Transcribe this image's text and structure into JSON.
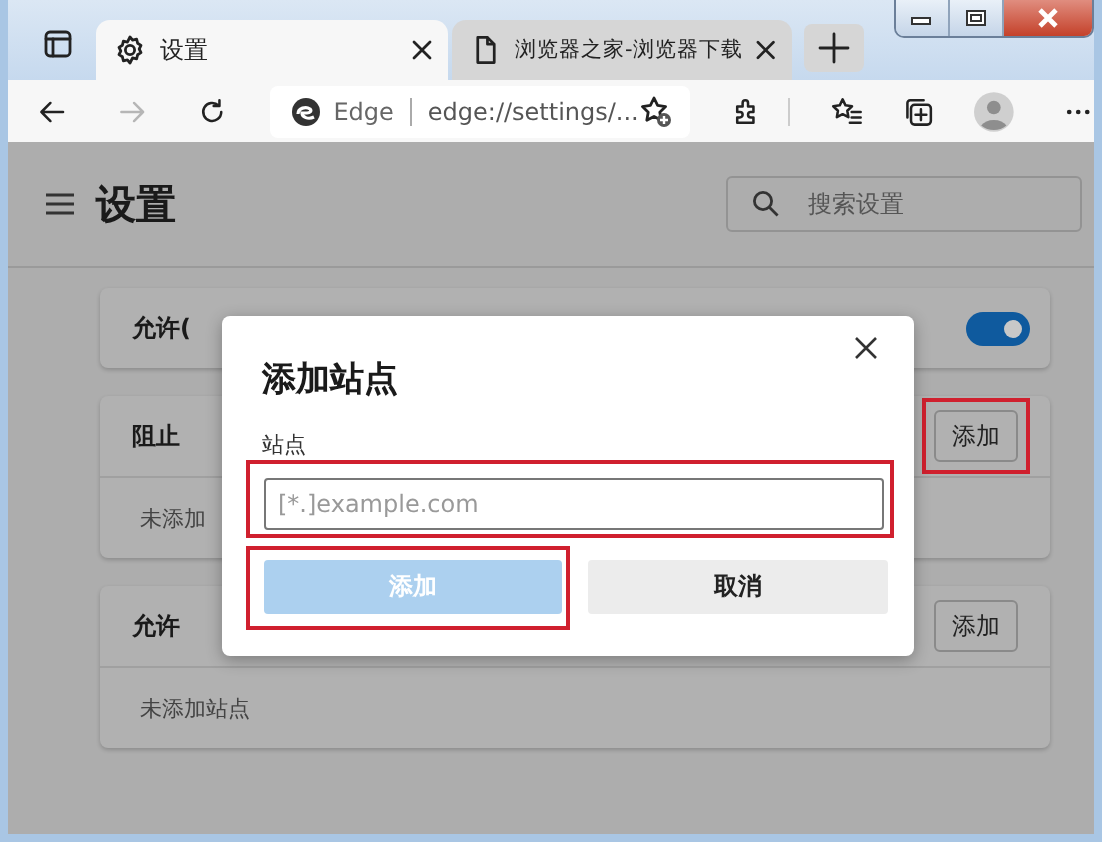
{
  "tabs": [
    {
      "kind": "settings",
      "title": "设置",
      "selected": true
    },
    {
      "kind": "page",
      "title": "浏览器之家-浏览器下载",
      "selected": false
    }
  ],
  "nav_buttons": [
    {
      "kind": "back",
      "disabled": false
    },
    {
      "kind": "forward",
      "disabled": true
    },
    {
      "kind": "refresh",
      "disabled": false
    }
  ],
  "address_bar": {
    "site_label": "Edge",
    "url": "edge://settings/..."
  },
  "page": {
    "title": "设置",
    "search": {
      "placeholder": "搜索设置"
    }
  },
  "sections": [
    {
      "kind": "toggle",
      "label": "允许(",
      "on": true
    },
    {
      "kind": "list",
      "label": "阻止",
      "button": {
        "label": "添加",
        "highlighted": true
      },
      "empty_text": "未添加"
    },
    {
      "kind": "list",
      "label": "允许",
      "button": {
        "label": "添加",
        "highlighted": false
      },
      "empty_text": "未添加站点"
    }
  ],
  "dialog": {
    "title": "添加站点",
    "field_label": "站点",
    "field": {
      "placeholder": "[*.]example.com",
      "highlighted": true
    },
    "buttons": [
      {
        "kind": "primary",
        "label": "添加",
        "disabled": true,
        "highlighted": true
      },
      {
        "kind": "secondary",
        "label": "取消",
        "disabled": false,
        "highlighted": false
      }
    ]
  }
}
